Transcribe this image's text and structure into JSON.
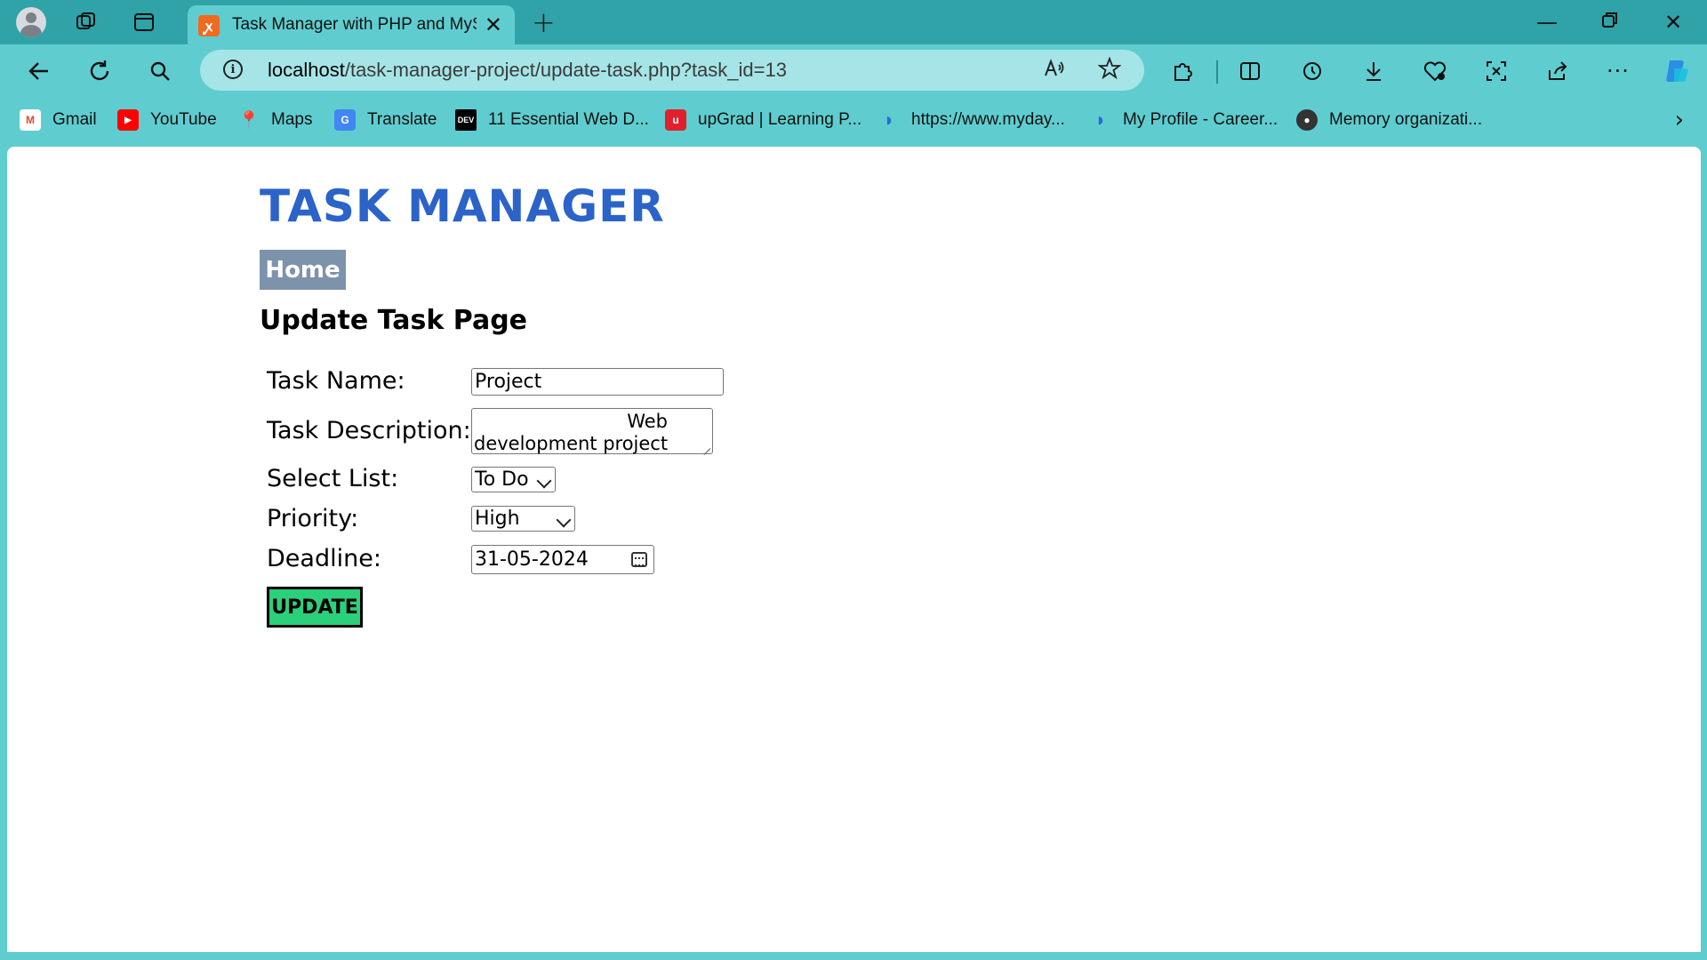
{
  "browser": {
    "tab_title": "Task Manager with PHP and MyS",
    "favicon_text": "ꭙ",
    "url_host": "localhost",
    "url_path": "/task-manager-project/update-task.php?task_id=13",
    "bookmarks": [
      {
        "label": "Gmail",
        "icon": "gmail-icon",
        "color": "#ea4335",
        "glyph": "M"
      },
      {
        "label": "YouTube",
        "icon": "youtube-icon",
        "color": "#ff0000",
        "glyph": "▶"
      },
      {
        "label": "Maps",
        "icon": "maps-icon",
        "color": "#34a853",
        "glyph": "◆"
      },
      {
        "label": "Translate",
        "icon": "translate-icon",
        "color": "#4285f4",
        "glyph": "G"
      },
      {
        "label": "11 Essential Web D...",
        "icon": "dev-icon",
        "color": "#000000",
        "glyph": "DEV"
      },
      {
        "label": "upGrad | Learning P...",
        "icon": "upgrad-icon",
        "color": "#e0202f",
        "glyph": "u"
      },
      {
        "label": "https://www.myday...",
        "icon": "myday-icon",
        "color": "#2b6cd6",
        "glyph": "◐"
      },
      {
        "label": "My Profile - Career...",
        "icon": "career-icon",
        "color": "#2b6cd6",
        "glyph": "◐"
      },
      {
        "label": "Memory organizati...",
        "icon": "memory-icon",
        "color": "#333333",
        "glyph": "●"
      }
    ]
  },
  "page": {
    "title": "TASK MANAGER",
    "home_label": "Home",
    "subtitle": "Update Task Page",
    "form": {
      "task_name_label": "Task Name:",
      "task_name_value": "Project",
      "description_label": "Task Description:",
      "description_line1": "Web",
      "description_line2": "development project",
      "list_label": "Select List:",
      "list_value": "To Do",
      "priority_label": "Priority:",
      "priority_value": "High",
      "deadline_label": "Deadline:",
      "deadline_value": "31-05-2024",
      "update_label": "UPDATE"
    }
  },
  "colors": {
    "chrome": "#5fcdcf",
    "titlebar": "#2fa3a8",
    "title_blue": "#2b63c8",
    "home_bg": "#7d93ab",
    "update_green": "#2bd07a"
  }
}
